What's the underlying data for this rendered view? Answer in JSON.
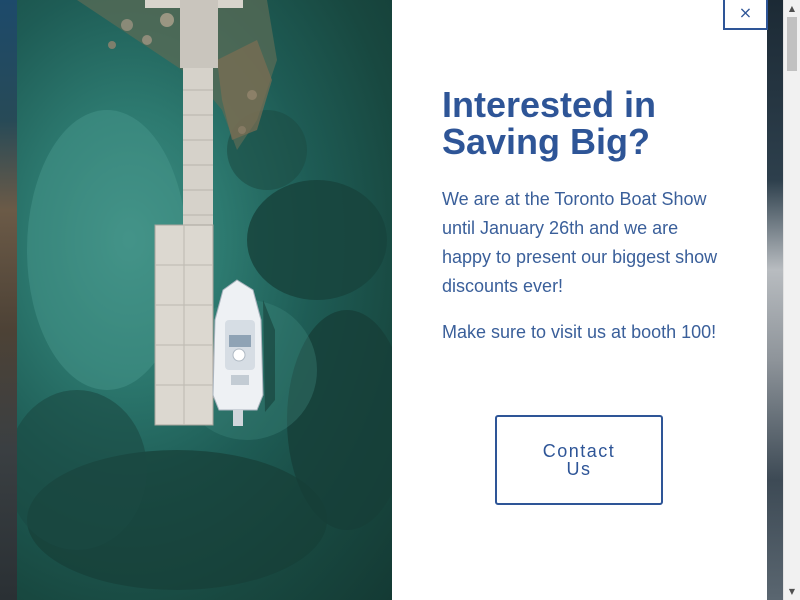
{
  "modal": {
    "headline": "Interested in Saving Big?",
    "paragraphs": [
      "We are at the Toronto Boat Show until January 26th and we are happy to present our biggest show discounts ever!",
      "Make sure to visit us at booth 100!"
    ],
    "cta_label": "Contact Us",
    "close_label": "×",
    "image_alt": "Aerial view of a white boat docked at a floating pier over clear turquoise water"
  },
  "scrollbar": {
    "up_arrow": "▲",
    "down_arrow": "▼"
  },
  "colors": {
    "brand_blue": "#2e5597",
    "text_blue": "#3a5f9a",
    "water_teal": "#2d7a70"
  }
}
